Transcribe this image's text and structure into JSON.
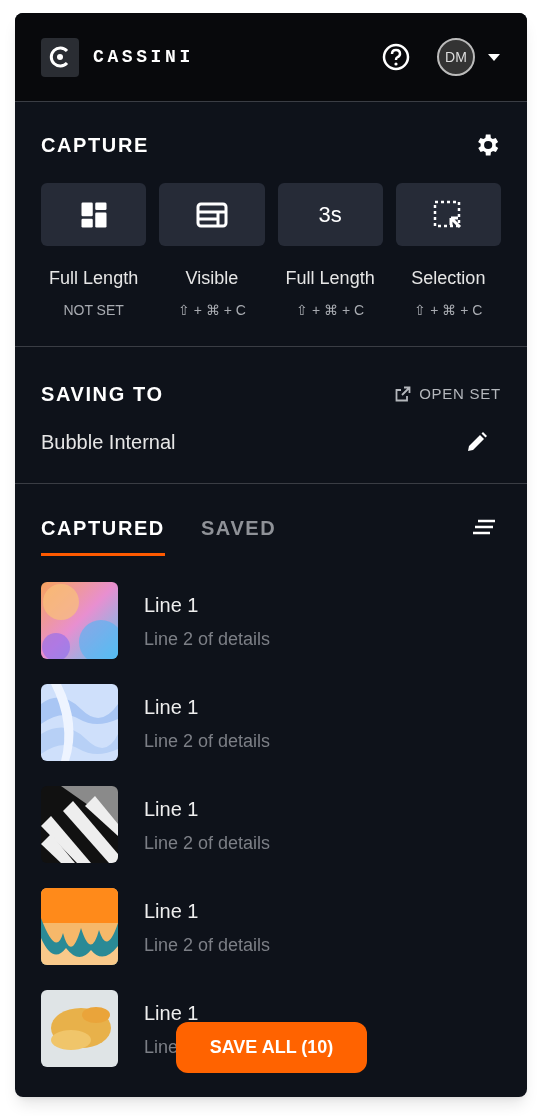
{
  "header": {
    "brand": "CASSINI",
    "avatar": "DM"
  },
  "capture": {
    "title": "CAPTURE",
    "modes": [
      {
        "kind": "icon",
        "label": "Full Length",
        "shortcut": "NOT SET"
      },
      {
        "kind": "icon",
        "label": "Visible",
        "shortcut": "⇧ + ⌘ + C"
      },
      {
        "kind": "text",
        "glyph": "3s",
        "label": "Full Length",
        "shortcut": "⇧ + ⌘ + C"
      },
      {
        "kind": "icon",
        "label": "Selection",
        "shortcut": "⇧ + ⌘ + C"
      }
    ]
  },
  "saving": {
    "title": "SAVING TO",
    "open_link": "OPEN SET",
    "set_name": "Bubble Internal"
  },
  "tabs": [
    {
      "label": "CAPTURED",
      "selected": true
    },
    {
      "label": "SAVED",
      "selected": false
    }
  ],
  "items": [
    {
      "kind": "picture",
      "title": "Line 1",
      "subtitle": "Line 2 of details"
    },
    {
      "kind": "picture",
      "title": "Line 1",
      "subtitle": "Line 2 of details"
    },
    {
      "kind": "picture",
      "title": "Line 1",
      "subtitle": "Line 2 of details"
    },
    {
      "kind": "picture",
      "title": "Line 1",
      "subtitle": "Line 2 of details"
    },
    {
      "kind": "picture",
      "title": "Line 1",
      "subtitle": "Line"
    }
  ],
  "save_button": "SAVE ALL (10)"
}
